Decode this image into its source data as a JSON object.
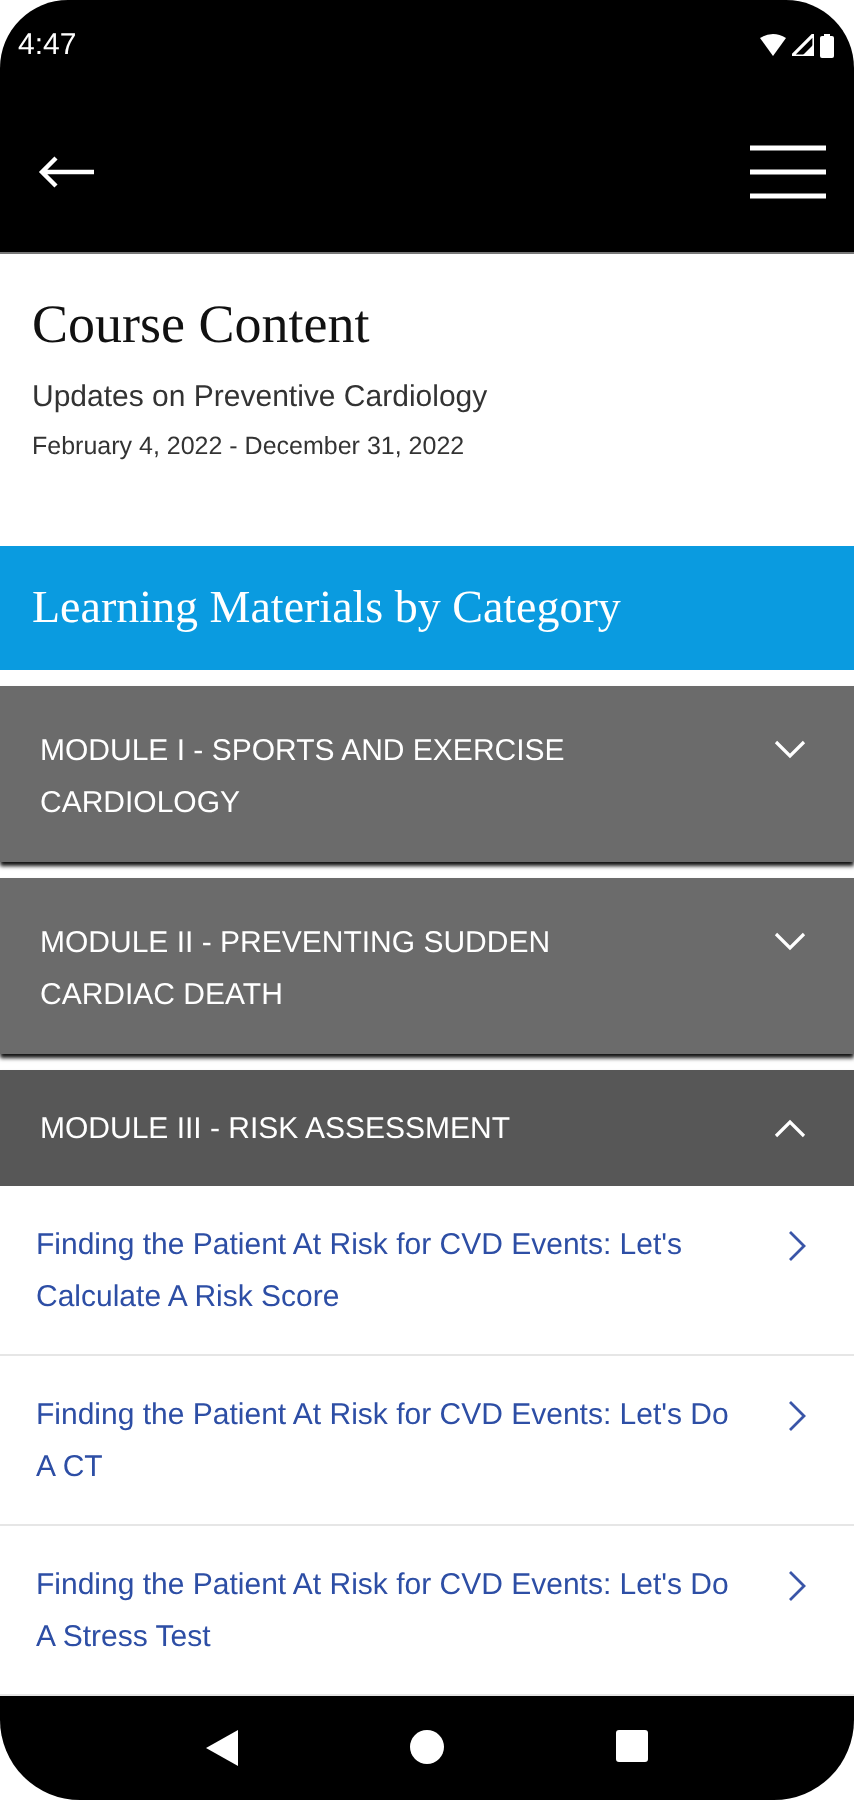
{
  "status_bar": {
    "time": "4:47"
  },
  "header": {
    "title": "Course Content",
    "course": "Updates on Preventive Cardiology",
    "dates": "February 4, 2022 - December 31, 2022"
  },
  "category_banner": {
    "title": "Learning Materials by Category"
  },
  "modules": [
    {
      "title": "MODULE I - SPORTS AND EXERCISE CARDIOLOGY",
      "expanded": false
    },
    {
      "title": "MODULE II - PREVENTING SUDDEN CARDIAC DEATH",
      "expanded": false
    },
    {
      "title": "MODULE III - RISK ASSESSMENT",
      "expanded": true,
      "children": [
        {
          "title": "Finding the Patient At Risk for CVD Events: Let's Calculate A Risk Score"
        },
        {
          "title": "Finding the Patient At Risk for CVD Events: Let's Do A CT"
        },
        {
          "title": "Finding the Patient At Risk for CVD Events: Let's Do A Stress Test"
        }
      ]
    }
  ]
}
